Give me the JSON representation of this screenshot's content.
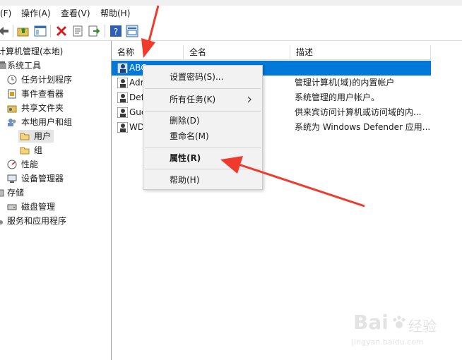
{
  "menu": {
    "file_partial": "(F)",
    "action": "操作(A)",
    "view": "查看(V)",
    "help": "帮助(H)"
  },
  "tree": {
    "root": "计算机管理(本地)",
    "system_tools": "系统工具",
    "task_scheduler": "任务计划程序",
    "event_viewer": "事件查看器",
    "shared_folders": "共享文件夹",
    "local_users_groups": "本地用户和组",
    "users": "用户",
    "groups": "组",
    "performance": "性能",
    "device_manager": "设备管理器",
    "storage": "存储",
    "disk_management": "磁盘管理",
    "services_apps": "服务和应用程序"
  },
  "columns": {
    "name": "名称",
    "fullname": "全名",
    "description": "描述"
  },
  "rows": [
    {
      "name": "ABC",
      "fullname": "",
      "description": ""
    },
    {
      "name": "Adr",
      "fullname": "",
      "description": "管理计算机(域)的内置帐户"
    },
    {
      "name": "Def",
      "fullname": "",
      "description": "系统管理的用户帐户。"
    },
    {
      "name": "Gue",
      "fullname": "",
      "description": "供来宾访问计算机或访问域的内..."
    },
    {
      "name": "WD",
      "fullname": "",
      "description": "系统为 Windows Defender 应用..."
    }
  ],
  "context_menu": {
    "set_password": "设置密码(S)...",
    "all_tasks": "所有任务(K)",
    "delete": "删除(D)",
    "rename": "重命名(M)",
    "properties": "属性(R)",
    "help": "帮助(H)"
  },
  "watermark": {
    "brand": "Bai",
    "brand2": "经验",
    "url": "jingyan.baidu.com"
  },
  "colors": {
    "selection": "#0078d7",
    "annotation_arrow": "#f03a2c",
    "pane_border": "#a0a0a0"
  },
  "icons": [
    "back-arrow-icon",
    "up-folder-icon",
    "show-tree-icon",
    "delete-icon",
    "properties-icon",
    "export-icon",
    "help-icon",
    "action-pane-icon"
  ]
}
